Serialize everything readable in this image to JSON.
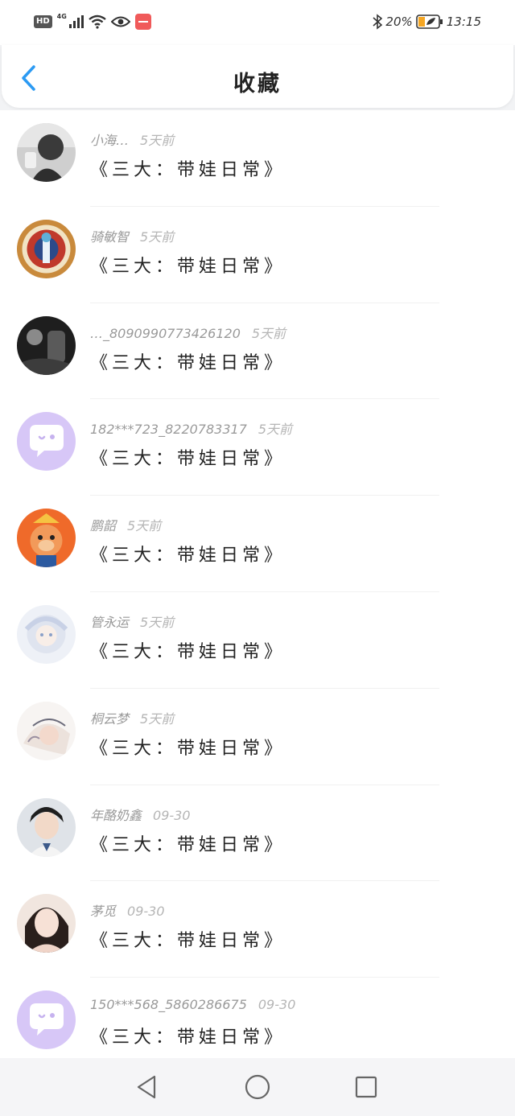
{
  "status_bar": {
    "hd": "HD",
    "network": "4G",
    "battery": "20%",
    "time": "13:15"
  },
  "header": {
    "title": "收藏"
  },
  "favorites": [
    {
      "user": "小海…",
      "time": "5天前",
      "title": "《三大：带娃日常》",
      "avatar": "photo-girl-grey"
    },
    {
      "user": "骑敏智",
      "time": "5天前",
      "title": "《三大：带娃日常》",
      "avatar": "anime-medallion"
    },
    {
      "user": "…_8090990773426120",
      "time": "5天前",
      "title": "《三大：带娃日常》",
      "avatar": "photo-dark"
    },
    {
      "user": "182***723_8220783317",
      "time": "5天前",
      "title": "《三大：带娃日常》",
      "avatar": "default-chat-icon"
    },
    {
      "user": "鹏韶",
      "time": "5天前",
      "title": "《三大：带娃日常》",
      "avatar": "cartoon-orange"
    },
    {
      "user": "管永运",
      "time": "5天前",
      "title": "《三大：带娃日常》",
      "avatar": "anime-white"
    },
    {
      "user": "桐云梦",
      "time": "5天前",
      "title": "《三大：带娃日常》",
      "avatar": "anime-sketch"
    },
    {
      "user": "年酪奶鑫",
      "time": "09-30",
      "title": "《三大：带娃日常》",
      "avatar": "photo-boy"
    },
    {
      "user": "茅觅",
      "time": "09-30",
      "title": "《三大：带娃日常》",
      "avatar": "photo-girl"
    },
    {
      "user": "150***568_5860286675",
      "time": "09-30",
      "title": "《三大：带娃日常》",
      "avatar": "default-chat-icon"
    }
  ],
  "colors": {
    "accent": "#2b9af3",
    "default_avatar": "#d7c7f7",
    "battery": "#f5a623"
  },
  "icons": [
    "back-arrow-icon",
    "bluetooth-icon",
    "battery-icon",
    "wifi-icon",
    "eye-icon",
    "nav-back-icon",
    "nav-home-icon",
    "nav-recents-icon"
  ]
}
